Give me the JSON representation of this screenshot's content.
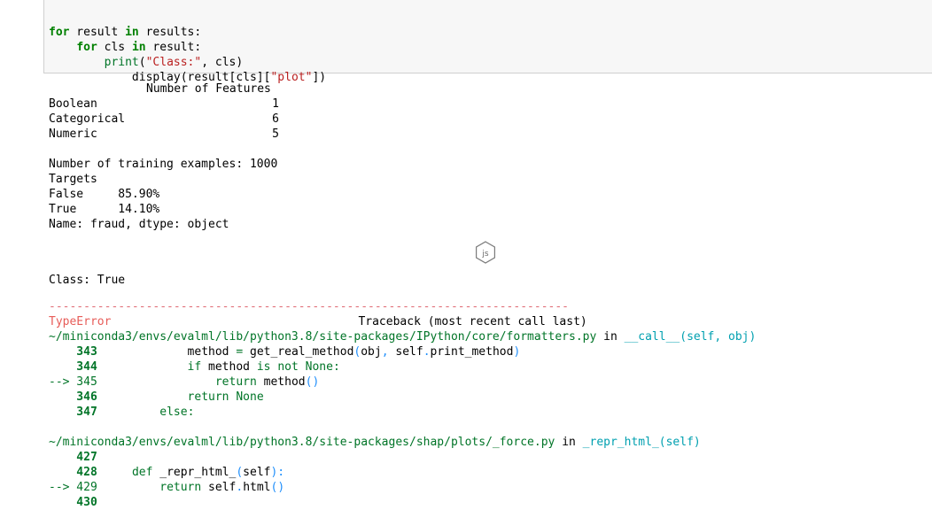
{
  "input_code": [
    {
      "indent": "",
      "kw1": "for",
      "mid1": " result ",
      "kw2": "in",
      "rest": " results:"
    },
    {
      "indent": "    ",
      "kw1": "for",
      "mid1": " cls ",
      "kw2": "in",
      "rest": " result:"
    },
    {
      "indent": "        ",
      "fn": "print",
      "open": "(",
      "str": "\"Class:\"",
      "rest": ", cls)"
    },
    {
      "indent": "            ",
      "fn": "display",
      "open": "(result[cls][",
      "str": "\"plot\"",
      "rest": "])"
    }
  ],
  "features_table": {
    "header": "Number of Features",
    "rows": [
      {
        "label": "Boolean",
        "value": "1"
      },
      {
        "label": "Categorical",
        "value": "6"
      },
      {
        "label": "Numeric",
        "value": "5"
      }
    ]
  },
  "training_text": {
    "examples": "Number of training examples: 1000",
    "targets": "Targets",
    "false_row": "False     85.90%",
    "true_row": "True      14.10%",
    "name_row": "Name: fraud, dtype: object"
  },
  "js_badge_label": "js",
  "class_line": "Class: True",
  "traceback": {
    "dashes": "---------------------------------------------------------------------------",
    "error_type": "TypeError",
    "header_right": "Traceback (most recent call last)",
    "frame1": {
      "path": "~/miniconda3/envs/evalml/lib/python3.8/site-packages/IPython/core/formatters.py",
      "in_word": "in",
      "func": "__call__(self, obj)",
      "lines": [
        {
          "marker": "    343",
          "code": "            method = get_real_method(obj, self.print_method)"
        },
        {
          "marker": "    344",
          "code": "            if method is not None:"
        },
        {
          "marker": "--> 345",
          "code": "                return method()"
        },
        {
          "marker": "    346",
          "code": "            return None"
        },
        {
          "marker": "    347",
          "code": "        else:"
        }
      ]
    },
    "frame2": {
      "path": "~/miniconda3/envs/evalml/lib/python3.8/site-packages/shap/plots/_force.py",
      "in_word": "in",
      "func": "_repr_html_(self)",
      "lines": [
        {
          "marker": "    427",
          "code": ""
        },
        {
          "marker": "    428",
          "code": "    def _repr_html_(self):"
        },
        {
          "marker": "--> 429",
          "code": "        return self.html()"
        },
        {
          "marker": "    430",
          "code": ""
        }
      ]
    }
  }
}
